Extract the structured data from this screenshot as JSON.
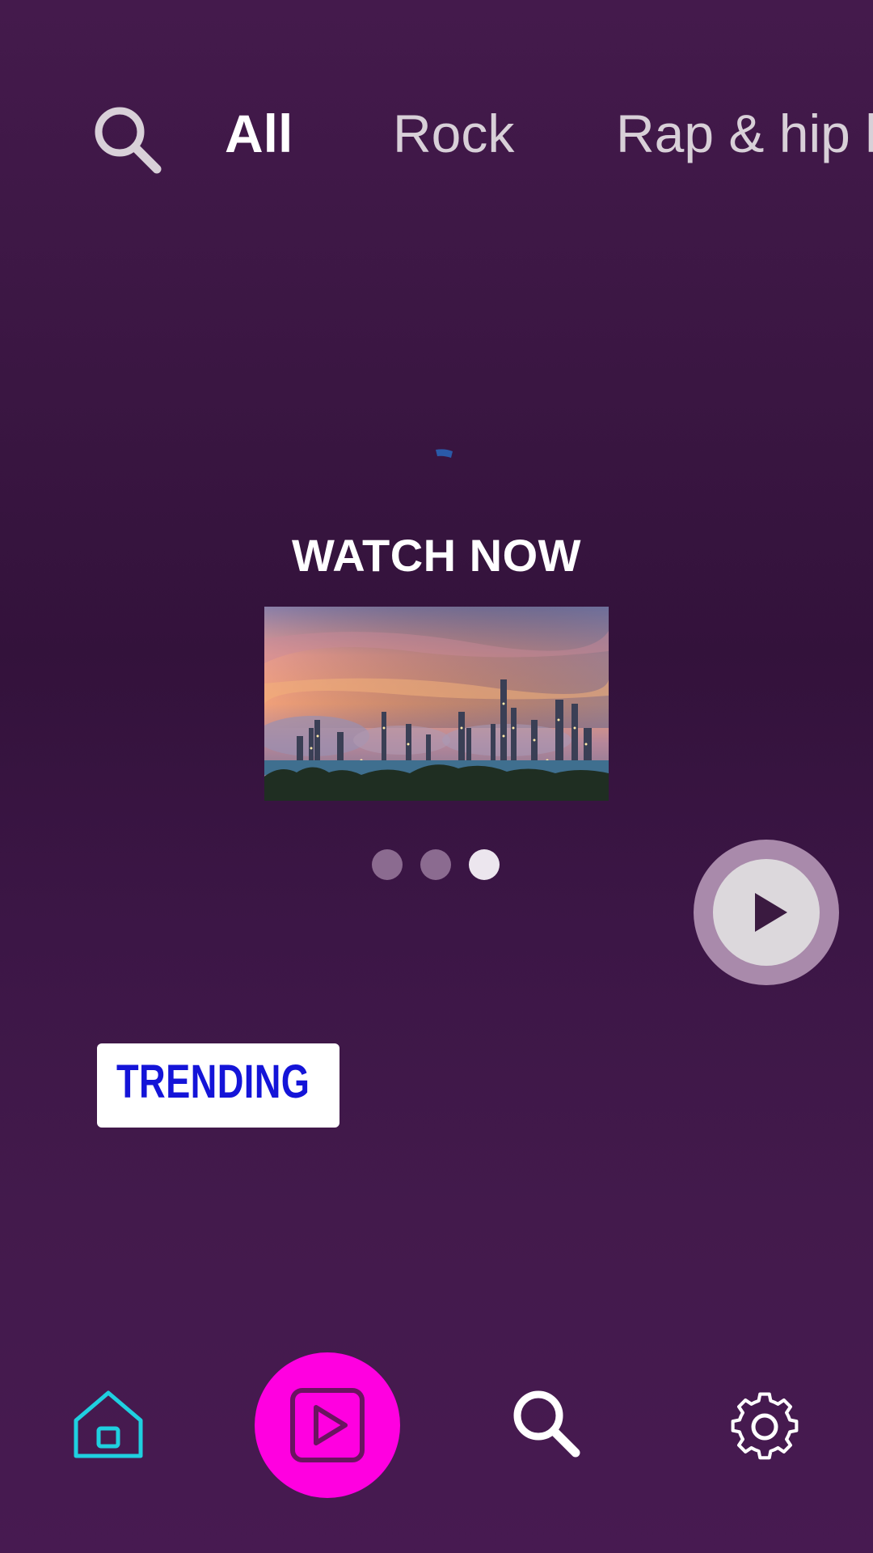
{
  "tabs": {
    "items": [
      {
        "label": "All",
        "active": true
      },
      {
        "label": "Rock",
        "active": false
      },
      {
        "label": "Rap & hip h",
        "active": false
      }
    ]
  },
  "featured": {
    "title": "WATCH NOW",
    "thumbnail_description_icon": "image-thumbnail",
    "carousel": {
      "count": 3,
      "active_index": 2
    }
  },
  "trending": {
    "label": "TRENDING"
  },
  "bottom_nav": {
    "items": [
      {
        "icon": "home-icon",
        "active": true
      },
      {
        "icon": "play-icon"
      },
      {
        "icon": "search-icon"
      },
      {
        "icon": "gear-icon"
      }
    ]
  },
  "colors": {
    "background": "#3a1642",
    "accent_magenta": "#ff00e0",
    "home_active": "#1fd0e0",
    "trending_text": "#1414d8"
  }
}
